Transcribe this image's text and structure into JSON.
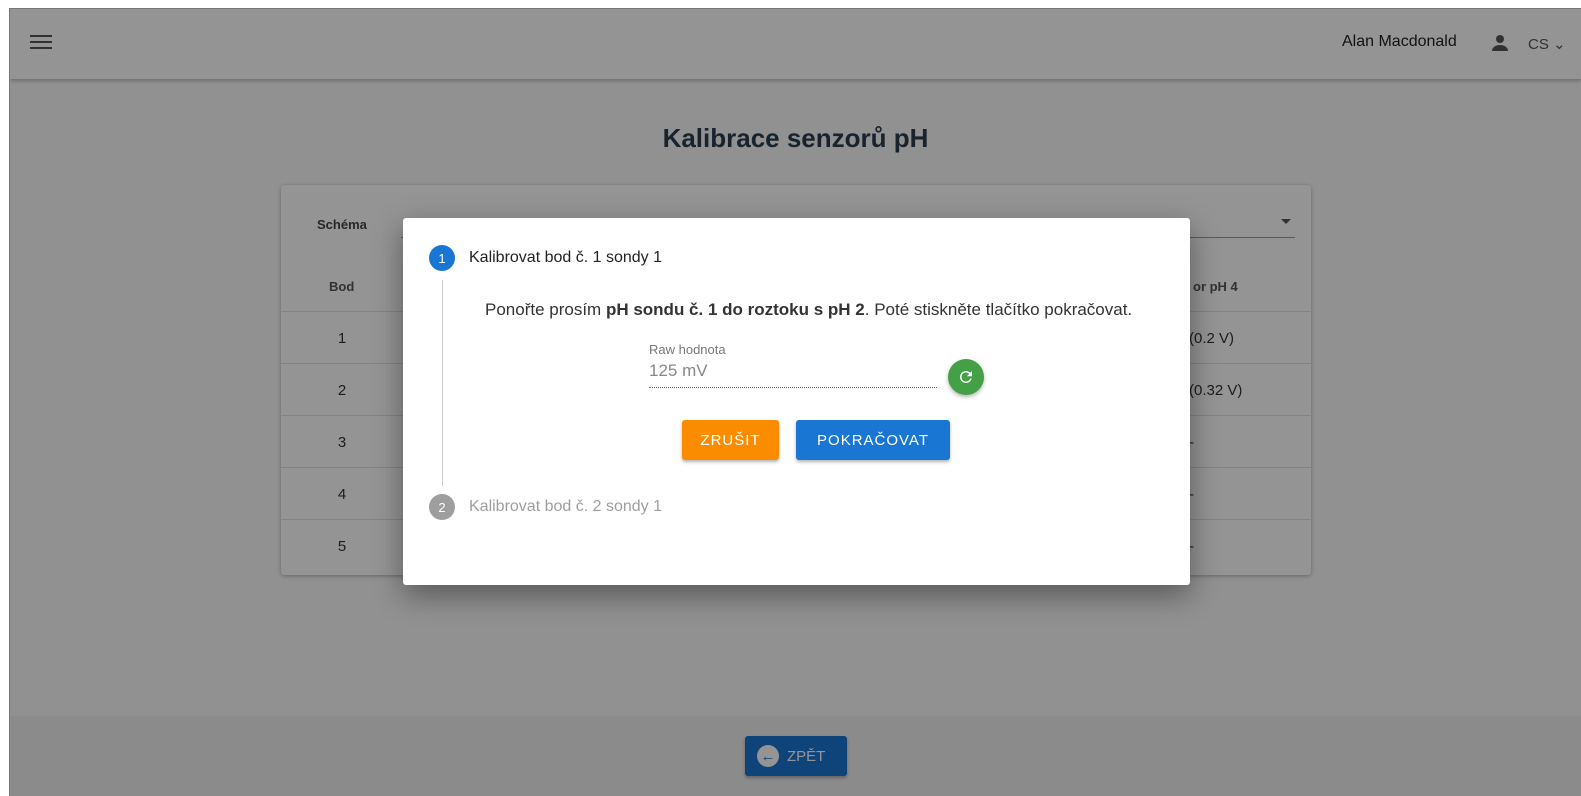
{
  "header": {
    "user_name": "Alan Macdonald",
    "language": "CS"
  },
  "page": {
    "title": "Kalibrace senzorů pH"
  },
  "table": {
    "schema_label": "Schéma",
    "col_bod": "Bod",
    "col_last": "or pH 4",
    "rows": [
      {
        "bod": "1",
        "last": "(0.2 V)"
      },
      {
        "bod": "2",
        "last": "(0.32 V)"
      },
      {
        "bod": "3",
        "last": "-"
      },
      {
        "bod": "4",
        "last": "-"
      },
      {
        "bod": "5",
        "last": "-"
      }
    ]
  },
  "dialog": {
    "step1": {
      "number": "1",
      "title": "Kalibrovat bod č. 1 sondy 1"
    },
    "step2": {
      "number": "2",
      "title": "Kalibrovat bod č. 2 sondy 1"
    },
    "instruction_prefix": "Ponořte prosím ",
    "instruction_bold": "pH sondu č. 1 do roztoku s pH 2",
    "instruction_suffix": ". Poté stiskněte tlačítko pokračovat.",
    "raw_label": "Raw hodnota",
    "raw_value": "125 mV",
    "cancel_label": "ZRUŠIT",
    "continue_label": "POKRAČOVAT"
  },
  "footer": {
    "back_label": "ZPĚT"
  },
  "colors": {
    "primary": "#1976d2",
    "cancel": "#fb8c00",
    "refresh": "#43a047"
  }
}
